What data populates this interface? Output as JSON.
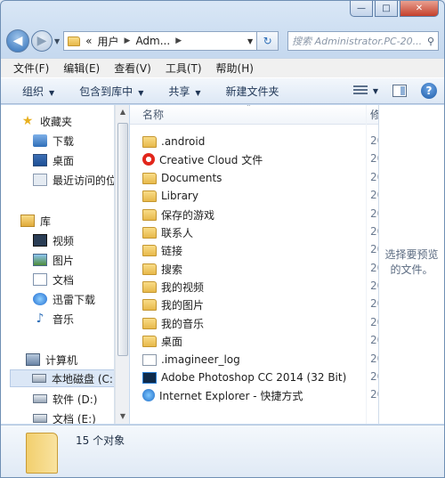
{
  "window": {
    "minimize_glyph": "—",
    "maximize_glyph": "□",
    "close_glyph": "✕"
  },
  "address": {
    "overflow_chevrons": "«",
    "crumbs": [
      "用户",
      "Adm..."
    ],
    "search_placeholder": "搜索 Administrator.PC-20..."
  },
  "menu": [
    "文件(F)",
    "编辑(E)",
    "查看(V)",
    "工具(T)",
    "帮助(H)"
  ],
  "commands": {
    "organize": "组织",
    "include_in_library": "包含到库中",
    "share": "共享",
    "new_folder": "新建文件夹"
  },
  "nav": {
    "favorites_header": "收藏夹",
    "favorites": [
      "下载",
      "桌面",
      "最近访问的位"
    ],
    "libraries_header": "库",
    "libraries": [
      "视频",
      "图片",
      "文档",
      "迅雷下载",
      "音乐"
    ],
    "computer_header": "计算机",
    "drives": [
      "本地磁盘 (C:)",
      "软件 (D:)",
      "文档 (E:)"
    ]
  },
  "files": {
    "column_name": "名称",
    "column_date": "修",
    "items": [
      {
        "name": ".android",
        "icon": "folder-icon"
      },
      {
        "name": "Creative Cloud 文件",
        "icon": "creative-cloud-icon"
      },
      {
        "name": "Documents",
        "icon": "folder-icon"
      },
      {
        "name": "Library",
        "icon": "folder-icon"
      },
      {
        "name": "保存的游戏",
        "icon": "saved-games-folder-icon"
      },
      {
        "name": "联系人",
        "icon": "contacts-folder-icon"
      },
      {
        "name": "链接",
        "icon": "links-folder-icon"
      },
      {
        "name": "搜索",
        "icon": "searches-folder-icon"
      },
      {
        "name": "我的视频",
        "icon": "videos-folder-icon"
      },
      {
        "name": "我的图片",
        "icon": "pictures-folder-icon"
      },
      {
        "name": "我的音乐",
        "icon": "music-folder-icon"
      },
      {
        "name": "桌面",
        "icon": "desktop-folder-icon"
      },
      {
        "name": ".imagineer_log",
        "icon": "file-icon"
      },
      {
        "name": "Adobe Photoshop CC 2014 (32 Bit)",
        "icon": "photoshop-shortcut-icon"
      },
      {
        "name": "Internet Explorer - 快捷方式",
        "icon": "internet-explorer-icon"
      }
    ],
    "date_prefix": "20"
  },
  "preview": {
    "message": "选择要预览的文件。"
  },
  "details": {
    "count": "15 个对象"
  }
}
